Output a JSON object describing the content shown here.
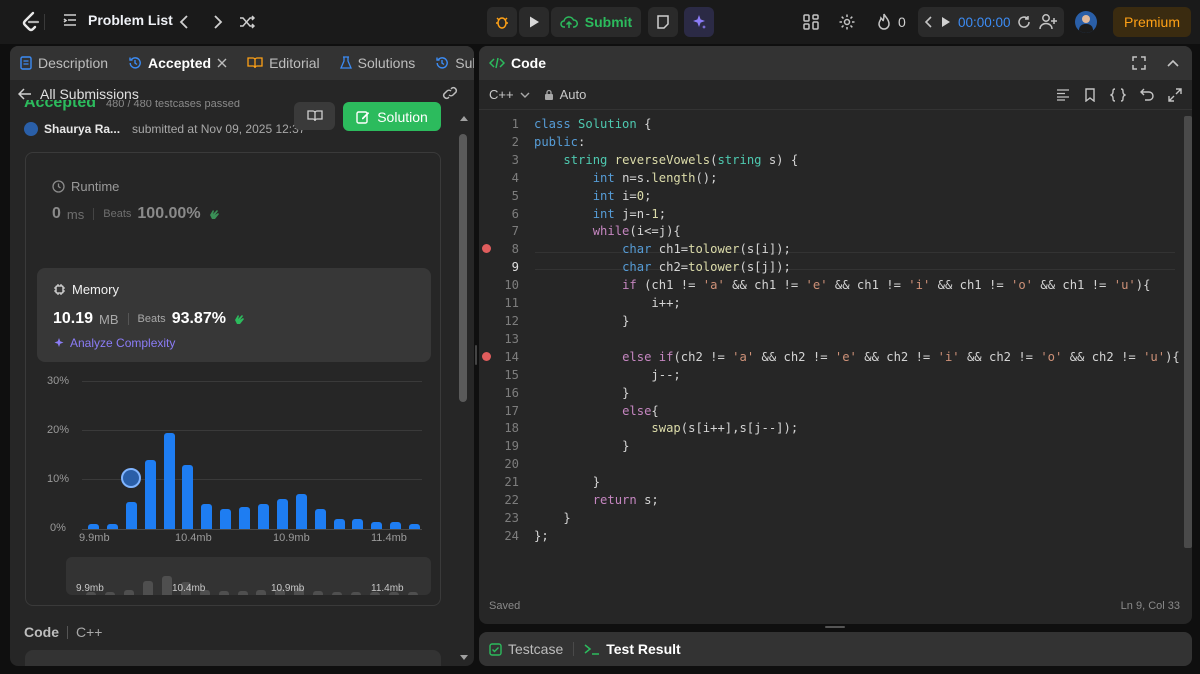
{
  "topbar": {
    "title": "Problem List",
    "submit": "Submit",
    "fire_count": "0",
    "timer": "00:00:00",
    "premium": "Premium"
  },
  "left": {
    "tabs": [
      "Description",
      "Accepted",
      "Editorial",
      "Solutions",
      "Submi"
    ],
    "back_label": "All Submissions",
    "status": "Accepted",
    "testcases": "480 / 480 testcases passed",
    "user": "Shaurya Ra...",
    "submitted": "submitted at Nov 09, 2025 12:37",
    "solution_btn": "Solution",
    "runtime": {
      "label": "Runtime",
      "value": "0",
      "unit": "ms",
      "beats_label": "Beats",
      "beats": "100.00%"
    },
    "memory": {
      "label": "Memory",
      "value": "10.19",
      "unit": "MB",
      "beats_label": "Beats",
      "beats": "93.87%"
    },
    "analyze": "Analyze Complexity",
    "code_label": "Code",
    "code_lang": "C++"
  },
  "chart_data": {
    "type": "bar",
    "ytick_labels": [
      "30%",
      "20%",
      "10%",
      "0%"
    ],
    "xtick_labels": [
      "9.9mb",
      "10.4mb",
      "10.9mb",
      "11.4mb"
    ],
    "ylim": [
      0,
      30
    ],
    "values": [
      1,
      1,
      5.5,
      14,
      19.5,
      13,
      5,
      4,
      4.5,
      5,
      6,
      7,
      4,
      2,
      2,
      1.5,
      1.5,
      1
    ],
    "user_bar_index": 2
  },
  "editor": {
    "title": "Code",
    "lang": "C++",
    "mode": "Auto",
    "status": "Saved",
    "position": "Ln 9, Col 33",
    "lines": [
      "1",
      "2",
      "3",
      "4",
      "5",
      "6",
      "7",
      "8",
      "9",
      "10",
      "11",
      "12",
      "13",
      "14",
      "15",
      "16",
      "17",
      "18",
      "19",
      "20",
      "21",
      "22",
      "23",
      "24"
    ],
    "breakpoints": [
      8,
      14
    ]
  },
  "bottom": {
    "testcase": "Testcase",
    "result": "Test Result"
  }
}
